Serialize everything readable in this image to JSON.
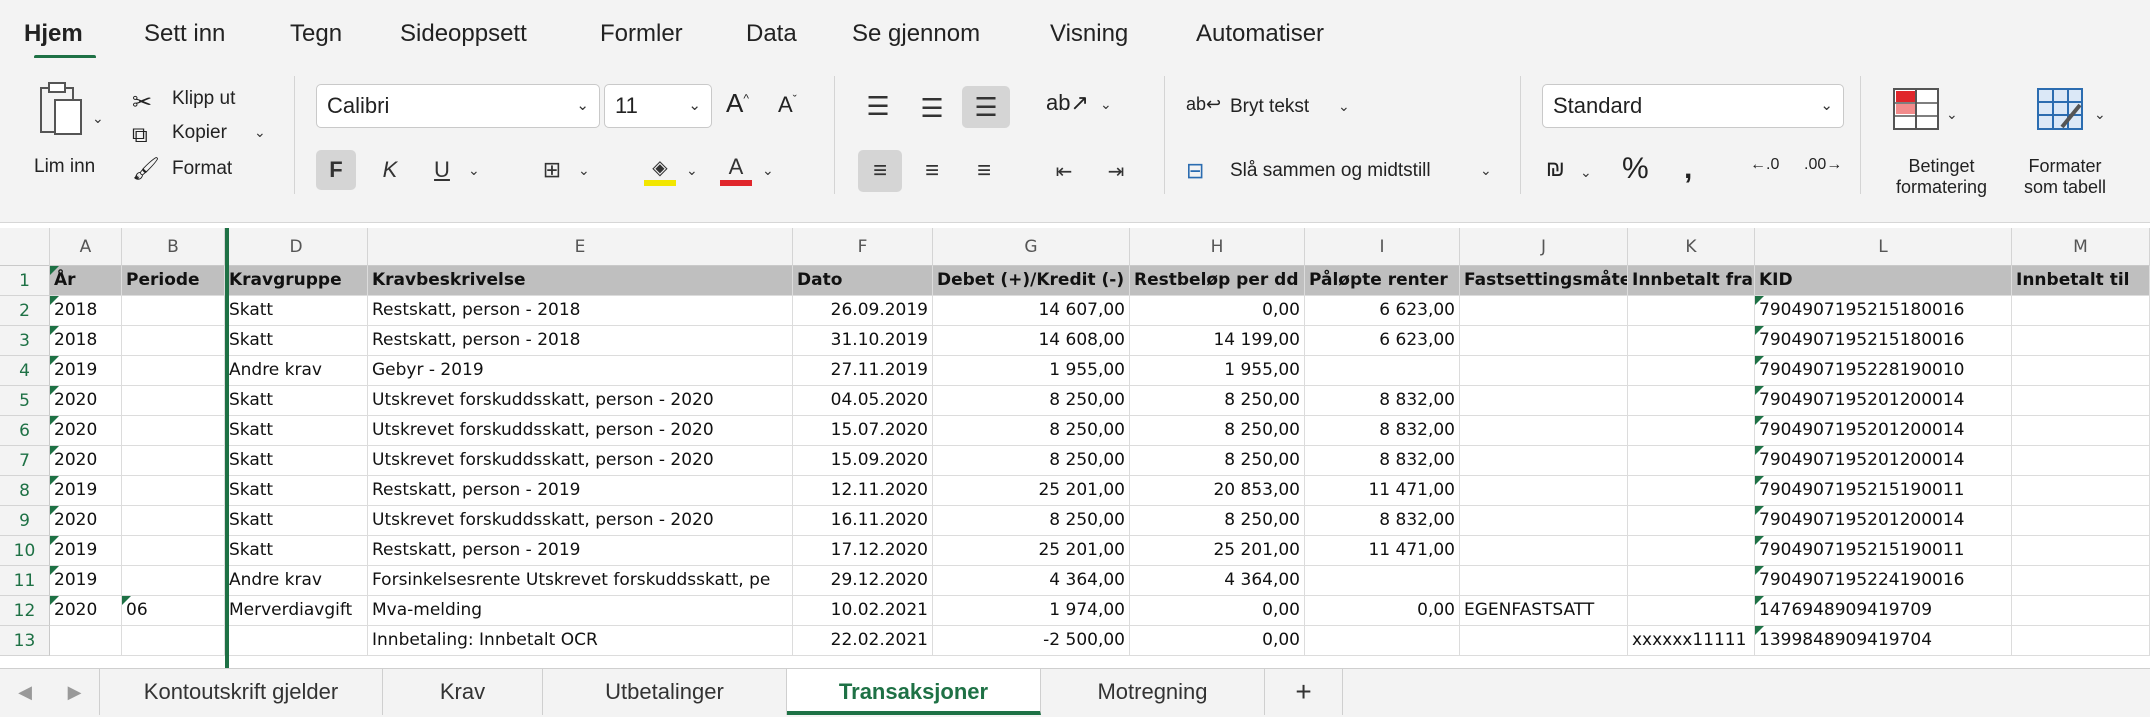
{
  "ribbon_tabs": [
    "Hjem",
    "Sett inn",
    "Tegn",
    "Sideoppsett",
    "Formler",
    "Data",
    "Se gjennom",
    "Visning",
    "Automatiser"
  ],
  "clipboard": {
    "paste": "Lim inn",
    "cut": "Klipp ut",
    "copy": "Kopier",
    "format": "Format"
  },
  "font": {
    "name": "Calibri",
    "size": "11",
    "bold": "F",
    "italic": "K",
    "underline": "U"
  },
  "alignment": {
    "wrap": "Bryt tekst",
    "merge": "Slå sammen og midtstill"
  },
  "number": {
    "format": "Standard"
  },
  "styles": {
    "conditional_l1": "Betinget",
    "conditional_l2": "formatering",
    "table_l1": "Formater",
    "table_l2": "som tabell"
  },
  "columns": [
    "A",
    "B",
    "D",
    "E",
    "F",
    "G",
    "H",
    "I",
    "J",
    "K",
    "L",
    "M"
  ],
  "row_numbers": [
    "1",
    "2",
    "3",
    "4",
    "5",
    "6",
    "7",
    "8",
    "9",
    "10",
    "11",
    "12",
    "13"
  ],
  "rows": [
    [
      "År",
      "Periode",
      "Kravgruppe",
      "Kravbeskrivelse",
      "Dato",
      "Debet (+)/Kredit (-)",
      "Restbeløp per dd",
      "Påløpte renter",
      "Fastsettingsmåte",
      "Innbetalt fra",
      "KID",
      "Innbetalt til"
    ],
    [
      "2018",
      "",
      "Skatt",
      "Restskatt, person - 2018",
      "26.09.2019",
      "14 607,00",
      "0,00",
      "6 623,00",
      "",
      "",
      "7904907195215180016",
      ""
    ],
    [
      "2018",
      "",
      "Skatt",
      "Restskatt, person - 2018",
      "31.10.2019",
      "14 608,00",
      "14 199,00",
      "6 623,00",
      "",
      "",
      "7904907195215180016",
      ""
    ],
    [
      "2019",
      "",
      "Andre krav",
      "Gebyr - 2019",
      "27.11.2019",
      "1 955,00",
      "1 955,00",
      "",
      "",
      "",
      "7904907195228190010",
      ""
    ],
    [
      "2020",
      "",
      "Skatt",
      "Utskrevet forskuddsskatt, person - 2020",
      "04.05.2020",
      "8 250,00",
      "8 250,00",
      "8 832,00",
      "",
      "",
      "7904907195201200014",
      ""
    ],
    [
      "2020",
      "",
      "Skatt",
      "Utskrevet forskuddsskatt, person - 2020",
      "15.07.2020",
      "8 250,00",
      "8 250,00",
      "8 832,00",
      "",
      "",
      "7904907195201200014",
      ""
    ],
    [
      "2020",
      "",
      "Skatt",
      "Utskrevet forskuddsskatt, person - 2020",
      "15.09.2020",
      "8 250,00",
      "8 250,00",
      "8 832,00",
      "",
      "",
      "7904907195201200014",
      ""
    ],
    [
      "2019",
      "",
      "Skatt",
      "Restskatt, person - 2019",
      "12.11.2020",
      "25 201,00",
      "20 853,00",
      "11 471,00",
      "",
      "",
      "7904907195215190011",
      ""
    ],
    [
      "2020",
      "",
      "Skatt",
      "Utskrevet forskuddsskatt, person - 2020",
      "16.11.2020",
      "8 250,00",
      "8 250,00",
      "8 832,00",
      "",
      "",
      "7904907195201200014",
      ""
    ],
    [
      "2019",
      "",
      "Skatt",
      "Restskatt, person - 2019",
      "17.12.2020",
      "25 201,00",
      "25 201,00",
      "11 471,00",
      "",
      "",
      "7904907195215190011",
      ""
    ],
    [
      "2019",
      "",
      "Andre krav",
      "Forsinkelsesrente Utskrevet forskuddsskatt, pe",
      "29.12.2020",
      "4 364,00",
      "4 364,00",
      "",
      "",
      "",
      "7904907195224190016",
      ""
    ],
    [
      "2020",
      "06",
      "Merverdiavgift",
      "Mva-melding",
      "10.02.2021",
      "1 974,00",
      "0,00",
      "0,00",
      "EGENFASTSATT",
      "",
      "1476948909419709",
      ""
    ],
    [
      "",
      "",
      "",
      "Innbetaling: Innbetalt OCR",
      "22.02.2021",
      "-2 500,00",
      "0,00",
      "",
      "",
      "xxxxxx11111",
      "1399848909419704",
      ""
    ]
  ],
  "sheet_tabs": [
    "Kontoutskrift gjelder",
    "Krav",
    "Utbetalinger",
    "Transaksjoner",
    "Motregning"
  ],
  "active_sheet": "Transaksjoner",
  "add_sheet": "+",
  "accent_color": "#1e7145"
}
